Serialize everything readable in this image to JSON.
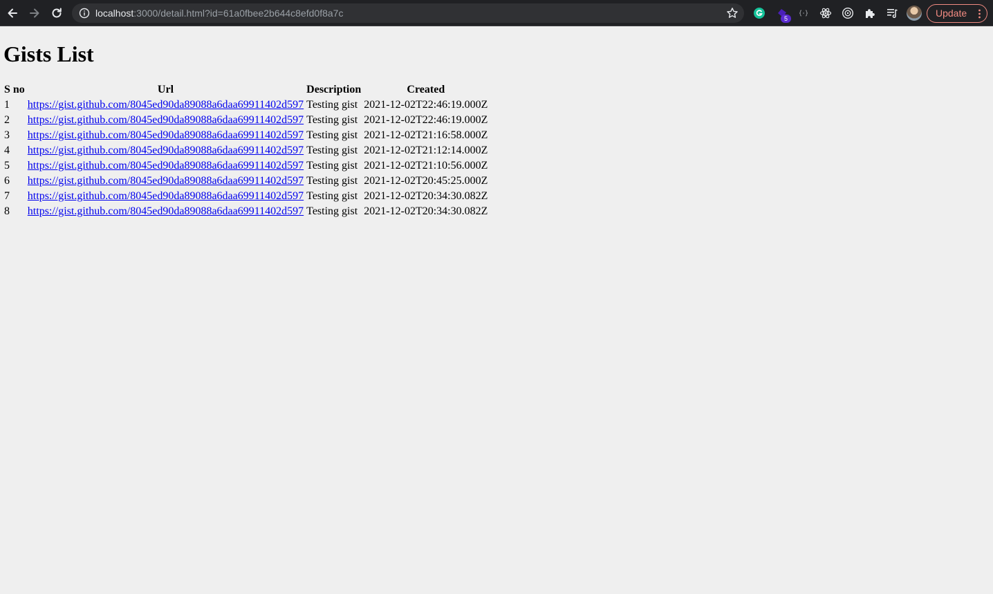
{
  "browser": {
    "url_host": "localhost",
    "url_rest": ":3000/detail.html?id=61a0fbee2b644c8efd0f8a7c",
    "extension_badge": "5",
    "update_label": "Update"
  },
  "page": {
    "title": "Gists List"
  },
  "table": {
    "headers": [
      "S no",
      "Url",
      "Description",
      "Created"
    ],
    "rows": [
      {
        "sno": "1",
        "url": "https://gist.github.com/8045ed90da89088a6daa69911402d597",
        "description": "Testing gist",
        "created": "2021-12-02T22:46:19.000Z"
      },
      {
        "sno": "2",
        "url": "https://gist.github.com/8045ed90da89088a6daa69911402d597",
        "description": "Testing gist",
        "created": "2021-12-02T22:46:19.000Z"
      },
      {
        "sno": "3",
        "url": "https://gist.github.com/8045ed90da89088a6daa69911402d597",
        "description": "Testing gist",
        "created": "2021-12-02T21:16:58.000Z"
      },
      {
        "sno": "4",
        "url": "https://gist.github.com/8045ed90da89088a6daa69911402d597",
        "description": "Testing gist",
        "created": "2021-12-02T21:12:14.000Z"
      },
      {
        "sno": "5",
        "url": "https://gist.github.com/8045ed90da89088a6daa69911402d597",
        "description": "Testing gist",
        "created": "2021-12-02T21:10:56.000Z"
      },
      {
        "sno": "6",
        "url": "https://gist.github.com/8045ed90da89088a6daa69911402d597",
        "description": "Testing gist",
        "created": "2021-12-02T20:45:25.000Z"
      },
      {
        "sno": "7",
        "url": "https://gist.github.com/8045ed90da89088a6daa69911402d597",
        "description": "Testing gist",
        "created": "2021-12-02T20:34:30.082Z"
      },
      {
        "sno": "8",
        "url": "https://gist.github.com/8045ed90da89088a6daa69911402d597",
        "description": "Testing gist",
        "created": "2021-12-02T20:34:30.082Z"
      }
    ]
  },
  "colors": {
    "link": "#0000ee",
    "update_accent": "#f28b82",
    "chrome_bg": "#202124",
    "page_bg": "#efefef"
  }
}
